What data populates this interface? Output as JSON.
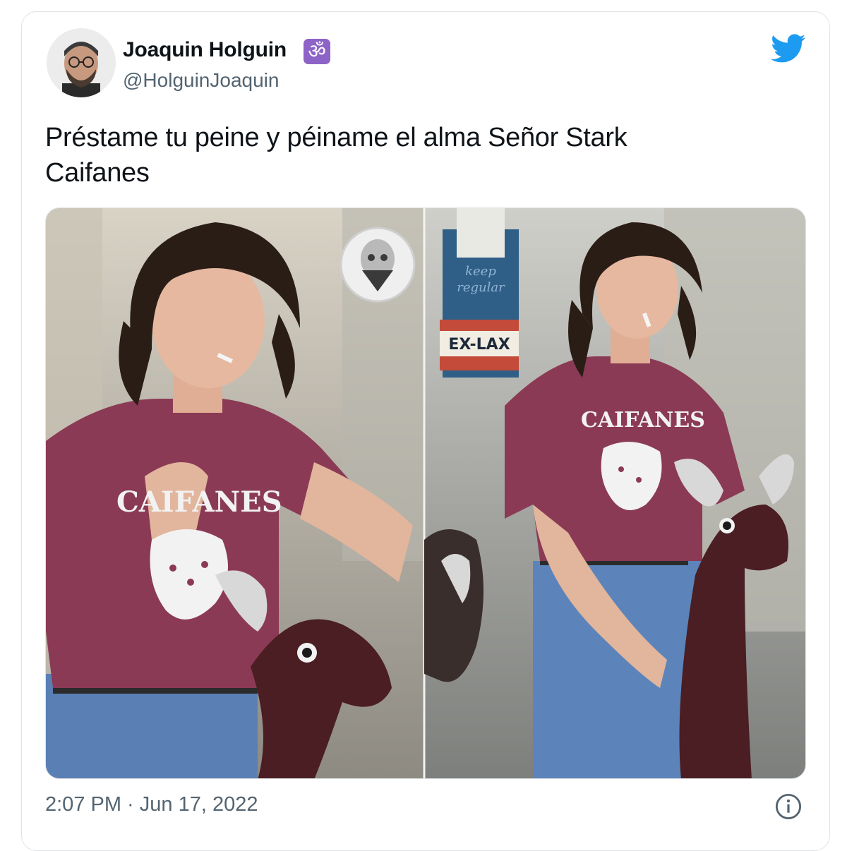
{
  "tweet": {
    "author_name": "Joaquin Holguin",
    "author_badge": "ॐ",
    "author_handle": "@HolguinJoaquin",
    "text_line1": "Préstame tu peine y péiname el alma Señor Stark",
    "text_line2": "Caifanes",
    "timestamp": "2:07 PM · Jun 17, 2022"
  },
  "media": {
    "left_shirt": "CAIFANES",
    "right_shirt": "CAIFANES",
    "store_sign_top": "keep regular",
    "store_sign_bottom": "EX-LAX"
  },
  "icons": {
    "platform": "twitter-bird-icon",
    "info": "info-icon"
  },
  "colors": {
    "twitter_blue": "#1d9bf0",
    "text_primary": "#0f1419",
    "text_secondary": "#536471",
    "badge_purple": "#8e63c7",
    "shirt_maroon": "#8b3a55"
  }
}
